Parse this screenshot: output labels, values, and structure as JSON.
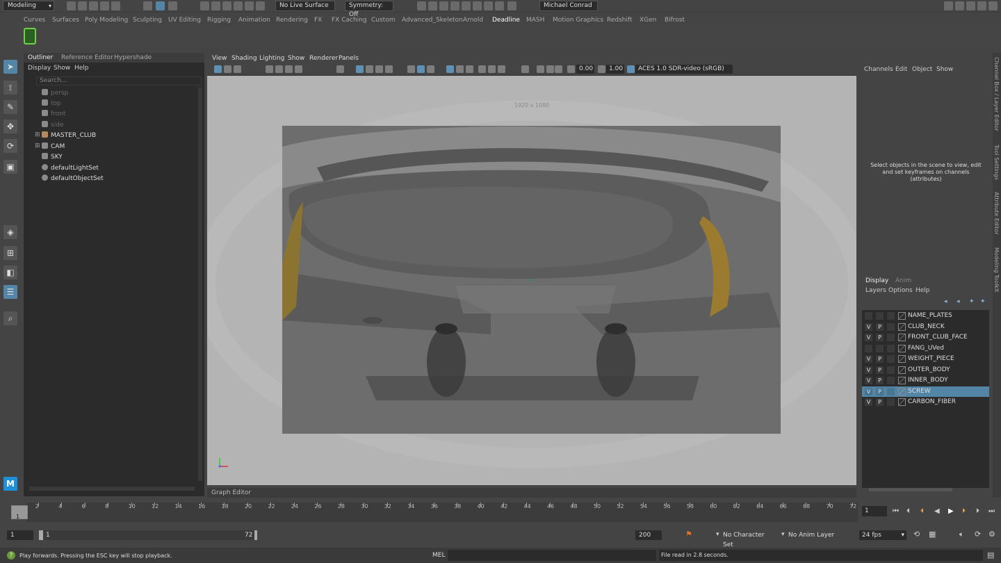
{
  "menuset": "Modeling",
  "topbar": {
    "live_surface": "No Live Surface",
    "symmetry": "Symmetry: Off",
    "user": "Michael Conrad"
  },
  "shelf_tabs": [
    "Curves",
    "Surfaces",
    "Poly Modeling",
    "Sculpting",
    "UV Editing",
    "Rigging",
    "Animation",
    "Rendering",
    "FX",
    "FX Caching",
    "Custom",
    "Advanced_Skeleton",
    "Arnold",
    "Deadline",
    "MASH",
    "Motion Graphics",
    "Redshift",
    "XGen",
    "Bifrost"
  ],
  "shelf_active": "Deadline",
  "outliner": {
    "tabs": [
      "Outliner",
      "Reference Editor",
      "Hypershade"
    ],
    "menus": [
      "Display",
      "Show",
      "Help"
    ],
    "search_placeholder": "Search...",
    "items": [
      {
        "label": "persp",
        "dim": true
      },
      {
        "label": "top",
        "dim": true
      },
      {
        "label": "front",
        "dim": true
      },
      {
        "label": "side",
        "dim": true
      },
      {
        "label": "MASTER_CLUB",
        "dim": false
      },
      {
        "label": "CAM",
        "dim": false
      },
      {
        "label": "SKY",
        "dim": false
      },
      {
        "label": "defaultLightSet",
        "dim": false
      },
      {
        "label": "defaultObjectSet",
        "dim": false
      }
    ]
  },
  "viewport": {
    "menus": [
      "View",
      "Shading",
      "Lighting",
      "Show",
      "Renderer",
      "Panels"
    ],
    "exposure": "0.00",
    "gamma": "1.00",
    "color_space": "ACES 1.0 SDR-video (sRGB)",
    "resolution": "1920 x 1080"
  },
  "channel_box": {
    "menus": [
      "Channels",
      "Edit",
      "Object",
      "Show"
    ],
    "message": "Select objects in the scene to view, edit and set keyframes on channels (attributes)"
  },
  "layers": {
    "tabs": [
      "Display",
      "Anim"
    ],
    "menus": [
      "Layers",
      "Options",
      "Help"
    ],
    "items": [
      {
        "name": "NAME_PLATES",
        "v": "",
        "p": "",
        "selected": false
      },
      {
        "name": "CLUB_NECK",
        "v": "V",
        "p": "P",
        "selected": false
      },
      {
        "name": "FRONT_CLUB_FACE",
        "v": "V",
        "p": "P",
        "selected": false
      },
      {
        "name": "FANG_UVed",
        "v": "",
        "p": "",
        "selected": false
      },
      {
        "name": "WEIGHT_PIECE",
        "v": "V",
        "p": "P",
        "selected": false
      },
      {
        "name": "OUTER_BODY",
        "v": "V",
        "p": "P",
        "selected": false
      },
      {
        "name": "INNER_BODY",
        "v": "V",
        "p": "P",
        "selected": false
      },
      {
        "name": "SCREW",
        "v": "V",
        "p": "P",
        "selected": true
      },
      {
        "name": "CARBON_FIBER",
        "v": "V",
        "p": "P",
        "selected": false
      }
    ]
  },
  "side_tabs": [
    "Channel Box / Layer Editor",
    "Tool Settings",
    "Attribute Editor",
    "Modeling Toolkit"
  ],
  "graph_editor_label": "Graph Editor",
  "timeline": {
    "ticks": [
      "2",
      "4",
      "6",
      "8",
      "10",
      "12",
      "14",
      "16",
      "18",
      "20",
      "22",
      "24",
      "26",
      "28",
      "30",
      "32",
      "34",
      "36",
      "38",
      "40",
      "42",
      "44",
      "46",
      "48",
      "50",
      "52",
      "54",
      "56",
      "58",
      "60",
      "62",
      "64",
      "66",
      "68",
      "70",
      "72"
    ],
    "current_marker": "1",
    "current_frame": "1"
  },
  "range": {
    "start": "1",
    "inner_start": "1",
    "inner_end": "72",
    "end": "200",
    "character_set": "No Character Set",
    "anim_layer": "No Anim Layer",
    "fps": "24 fps"
  },
  "status": {
    "help": "Play forwards. Pressing the ESC key will stop playback.",
    "mel": "MEL",
    "message": "File read in  2.8 seconds."
  }
}
